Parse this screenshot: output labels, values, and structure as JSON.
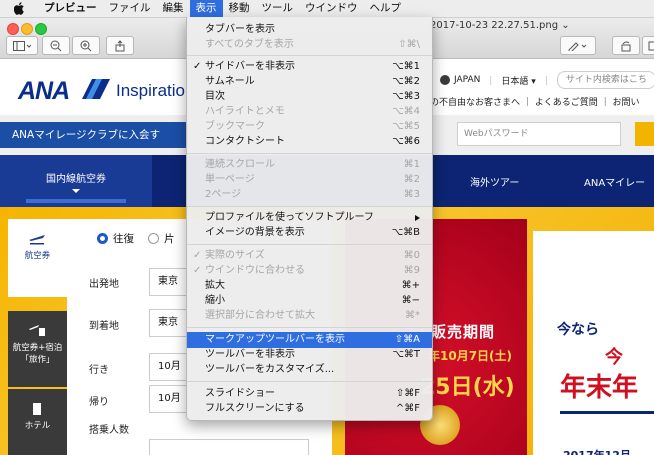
{
  "menubar": {
    "app": "プレビュー",
    "items": [
      "ファイル",
      "編集",
      "表示",
      "移動",
      "ツール",
      "ウインドウ",
      "ヘルプ"
    ],
    "active": "表示"
  },
  "window": {
    "title_fragment": "2017-10-23 22.27.51.png"
  },
  "menu": {
    "items": [
      {
        "label": "タブバーを表示",
        "shortcut": "",
        "check": false,
        "disabled": false
      },
      {
        "label": "すべてのタブを表示",
        "shortcut": "⇧⌘\\",
        "check": false,
        "disabled": true
      },
      {
        "label": "サイドバーを非表示",
        "shortcut": "⌥⌘1",
        "check": true,
        "disabled": false
      },
      {
        "label": "サムネール",
        "shortcut": "⌥⌘2",
        "check": false,
        "disabled": false
      },
      {
        "label": "目次",
        "shortcut": "⌥⌘3",
        "check": false,
        "disabled": false
      },
      {
        "label": "ハイライトとメモ",
        "shortcut": "⌥⌘4",
        "check": false,
        "disabled": true
      },
      {
        "label": "ブックマーク",
        "shortcut": "⌥⌘5",
        "check": false,
        "disabled": true
      },
      {
        "label": "コンタクトシート",
        "shortcut": "⌥⌘6",
        "check": false,
        "disabled": false
      },
      {
        "label": "連続スクロール",
        "shortcut": "⌘1",
        "check": false,
        "disabled": true
      },
      {
        "label": "単一ページ",
        "shortcut": "⌘2",
        "check": false,
        "disabled": true
      },
      {
        "label": "2ページ",
        "shortcut": "⌘3",
        "check": false,
        "disabled": true
      },
      {
        "label": "プロファイルを使ってソフトプルーフ",
        "shortcut": "",
        "check": false,
        "disabled": false,
        "submenu": true
      },
      {
        "label": "イメージの背景を表示",
        "shortcut": "⌥⌘B",
        "check": false,
        "disabled": false
      },
      {
        "label": "実際のサイズ",
        "shortcut": "⌘0",
        "check": true,
        "disabled": true
      },
      {
        "label": "ウインドウに合わせる",
        "shortcut": "⌘9",
        "check": true,
        "disabled": true
      },
      {
        "label": "拡大",
        "shortcut": "⌘+",
        "check": false,
        "disabled": false
      },
      {
        "label": "縮小",
        "shortcut": "⌘−",
        "check": false,
        "disabled": false
      },
      {
        "label": "選択部分に合わせて拡大",
        "shortcut": "⌘*",
        "check": false,
        "disabled": true
      },
      {
        "label": "マークアップツールバーを表示",
        "shortcut": "⇧⌘A",
        "check": false,
        "disabled": false,
        "highlighted": true
      },
      {
        "label": "ツールバーを非表示",
        "shortcut": "⌥⌘T",
        "check": false,
        "disabled": false
      },
      {
        "label": "ツールバーをカスタマイズ...",
        "shortcut": "",
        "check": false,
        "disabled": false
      },
      {
        "label": "スライドショー",
        "shortcut": "⇧⌘F",
        "check": false,
        "disabled": false
      },
      {
        "label": "フルスクリーンにする",
        "shortcut": "^⌘F",
        "check": false,
        "disabled": false
      }
    ]
  },
  "page": {
    "logo": "ANA",
    "tagline": "Inspiratio",
    "region": "JAPAN",
    "lang": "日本語 ▾",
    "search_placeholder": "サイト内検索はこち",
    "links": "の不自由なお客さまへ ｜ よくあるご質問 ｜ お問い",
    "amc_button": "ANAマイレージクラブに入会す",
    "password_placeholder": "Webパスワード",
    "nav": {
      "domestic": "国内線航空券",
      "tours": "海外ツアー",
      "mileage": "ANAマイレー"
    },
    "side": {
      "air": "航空券",
      "package": "航空券+宿泊「旅作」",
      "hotel": "ホテル"
    },
    "form": {
      "roundtrip": "往復",
      "oneway": "片",
      "from_label": "出発地",
      "from_value": "東京",
      "to_label": "到着地",
      "to_value": "東京",
      "depart_label": "行き",
      "depart_value": "10月",
      "return_label": "帰り",
      "return_value": "10月",
      "pax_label": "搭乗人数"
    },
    "banner": {
      "title": "・販売期間",
      "date1": "年10月7日(土)",
      "date2": "25日(水)",
      "right1": "今なら",
      "right2": "今",
      "right3": "年末年",
      "right4": "2017年12月"
    }
  }
}
